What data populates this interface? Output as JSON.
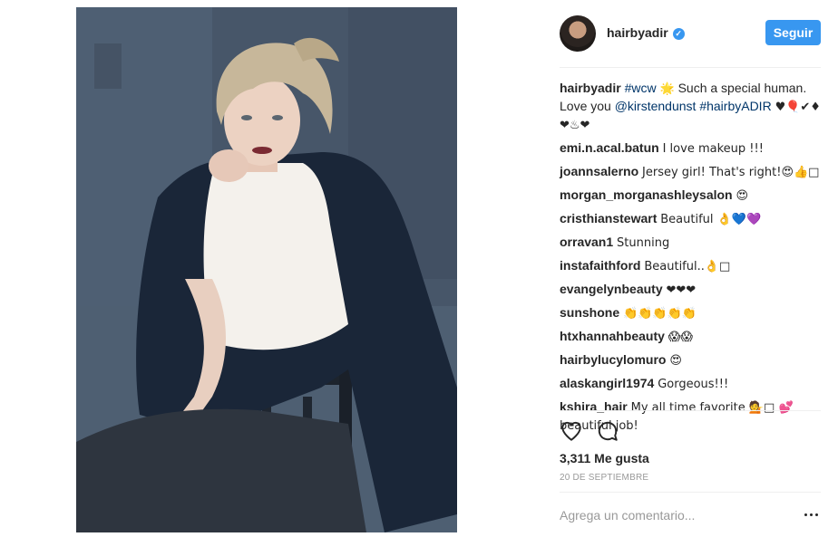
{
  "post": {
    "image_alt": "Portrait of a woman with tousled blonde hair in a white blouse and navy coat, seated on a chair"
  },
  "header": {
    "username": "hairbyadir",
    "follow_label": "Seguir"
  },
  "caption": {
    "user": "hairbyadir",
    "hashtag1": "#wcw",
    "text1": "Such a special human. Love you",
    "mention": "@kirstendunst",
    "hashtag2": "#hairbyADIR",
    "tail": "♥🎈✔♦❤♨❤"
  },
  "comments": [
    {
      "user": "emi.n.acal.batun",
      "text": "I love makeup !!!"
    },
    {
      "user": "joannsalerno",
      "text": "Jersey girl! That's right!😍👍□"
    },
    {
      "user": "morgan_morganashleysalon",
      "text": "😍"
    },
    {
      "user": "cristhianstewart",
      "text": "Beautiful 👌💙💜"
    },
    {
      "user": "orravan1",
      "text": "Stunning"
    },
    {
      "user": "instafaithford",
      "text": "Beautiful..👌□"
    },
    {
      "user": "evangelynbeauty",
      "text": "❤❤❤"
    },
    {
      "user": "sunshone",
      "text": "👏👏👏👏👏"
    },
    {
      "user": "htxhannahbeauty",
      "text": "😱😱"
    },
    {
      "user": "hairbylucylomuro",
      "text": "😍"
    },
    {
      "user": "alaskangirl1974",
      "text": "Gorgeous!!!"
    },
    {
      "user": "kshira_hair",
      "text": "My all time favorite 💁□ 💕 beautiful job!"
    }
  ],
  "stats": {
    "likes": "3,311 Me gusta",
    "date": "20 DE SEPTIEMBRE"
  },
  "comment_box": {
    "placeholder": "Agrega un comentario..."
  },
  "colors": {
    "accent": "#3897f0",
    "link": "#003569",
    "muted": "#999999"
  },
  "icons": {
    "verified": "verified-badge-icon",
    "like": "heart-outline-icon",
    "comment": "speech-bubble-icon",
    "more": "ellipsis-icon"
  }
}
